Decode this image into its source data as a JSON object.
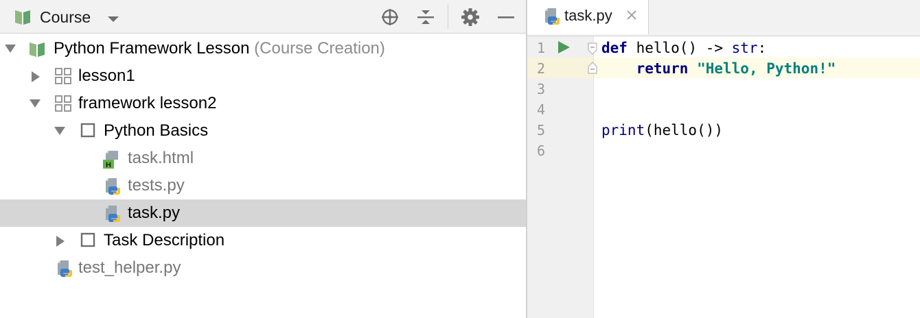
{
  "project_panel": {
    "title": "Course",
    "title_icon": "book-icon",
    "toolbar": {
      "locate_icon": "crosshair-icon",
      "collapse_icon": "collapse-all-icon",
      "settings_icon": "gear-icon",
      "hide_icon": "minimize-icon"
    },
    "tree": {
      "root": {
        "label": "Python Framework Lesson",
        "suffix": "(Course Creation)",
        "expanded": true
      },
      "lesson1": {
        "label": "lesson1",
        "expanded": false
      },
      "lesson2": {
        "label": "framework lesson2",
        "expanded": true
      },
      "task_python_basics": {
        "label": "Python Basics",
        "expanded": true
      },
      "file_task_html": {
        "label": "task.html"
      },
      "file_tests_py": {
        "label": "tests.py"
      },
      "file_task_py": {
        "label": "task.py",
        "selected": true
      },
      "task_description": {
        "label": "Task Description",
        "expanded": false
      },
      "file_test_helper": {
        "label": "test_helper.py"
      }
    }
  },
  "editor": {
    "tab": {
      "label": "task.py",
      "close_icon": "close-icon"
    },
    "line_numbers": [
      "1",
      "2",
      "3",
      "4",
      "5",
      "6"
    ],
    "code": {
      "l1_kw": "def",
      "l1_rest_a": " hello() -> ",
      "l1_type": "str",
      "l1_rest_b": ":",
      "l2_indent": "    ",
      "l2_kw": "return",
      "l2_space": " ",
      "l2_str": "\"Hello, Python!\"",
      "l5_fn": "print",
      "l5_rest": "(hello())"
    },
    "highlighted_line": 2
  },
  "colors": {
    "panel_bg": "#f2f2f2",
    "selection": "#d6d6d6",
    "keyword": "#000080",
    "string": "#008080",
    "run_green": "#499c54",
    "current_line": "#fefbe7"
  }
}
